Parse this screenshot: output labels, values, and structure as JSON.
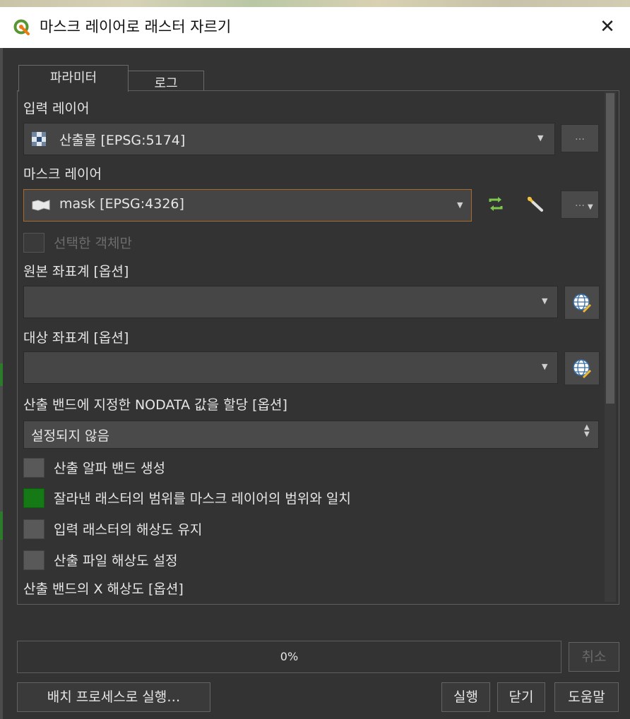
{
  "window": {
    "title": "마스크 레이어로 래스터 자르기",
    "close_symbol": "✕"
  },
  "tabs": [
    {
      "label": "파라미터",
      "active": true
    },
    {
      "label": "로그",
      "active": false
    }
  ],
  "params": {
    "input_layer": {
      "label": "입력 레이어",
      "value": "산출물 [EPSG:5174]",
      "icon": "raster-layer-icon",
      "browse_label": "…"
    },
    "mask_layer": {
      "label": "마스크 레이어",
      "value": "mask [EPSG:4326]",
      "icon": "polygon-layer-icon",
      "browse_label": "…"
    },
    "selected_only": {
      "label": "선택한 객체만",
      "checked": false,
      "enabled": false
    },
    "source_crs": {
      "label": "원본 좌표계 [옵션]",
      "value": ""
    },
    "target_crs": {
      "label": "대상 좌표계 [옵션]",
      "value": ""
    },
    "nodata": {
      "label": "산출 밴드에 지정한 NODATA 값을 할당 [옵션]",
      "value": "설정되지 않음"
    },
    "checkboxes": [
      {
        "label": "산출 알파 밴드 생성",
        "checked": false
      },
      {
        "label": "잘라낸 래스터의 범위를 마스크 레이어의 범위와 일치",
        "checked": true
      },
      {
        "label": "입력 래스터의 해상도 유지",
        "checked": false
      },
      {
        "label": "산출 파일 해상도 설정",
        "checked": false
      }
    ],
    "x_res_label": "산출 밴드의 X 해상도 [옵션]"
  },
  "progress": {
    "percent": 0,
    "text": "0%"
  },
  "buttons": {
    "cancel": "취소",
    "batch": "배치 프로세스로 실행…",
    "run": "실행",
    "close": "닫기",
    "help": "도움말"
  },
  "colors": {
    "checked_green": "#157a15",
    "mask_combo_border": "#a86a2a",
    "iterate_icon_green": "#7ec850"
  }
}
